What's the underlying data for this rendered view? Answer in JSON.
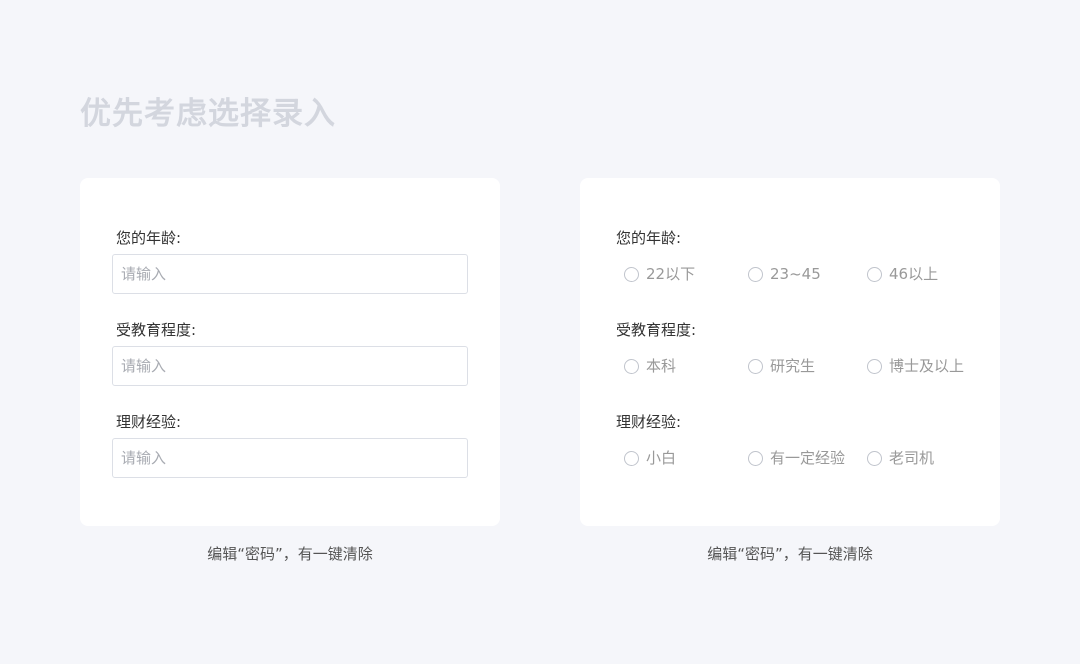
{
  "page_title": "优先考虑选择录入",
  "left_card": {
    "fields": [
      {
        "label": "您的年龄:",
        "placeholder": "请输入"
      },
      {
        "label": "受教育程度:",
        "placeholder": "请输入"
      },
      {
        "label": "理财经验:",
        "placeholder": "请输入"
      }
    ],
    "caption": "编辑“密码”，有一键清除"
  },
  "right_card": {
    "groups": [
      {
        "label": "您的年龄:",
        "options": [
          "22以下",
          "23~45",
          "46以上"
        ]
      },
      {
        "label": "受教育程度:",
        "options": [
          "本科",
          "研究生",
          "博士及以上"
        ]
      },
      {
        "label": "理财经验:",
        "options": [
          "小白",
          "有一定经验",
          "老司机"
        ]
      }
    ],
    "caption": "编辑“密码”，有一键清除"
  },
  "colors": {
    "background": "#f5f6fa",
    "card": "#ffffff",
    "title": "#d3d6de",
    "label": "#333333",
    "placeholder": "#a8abb2",
    "border": "#dcdfe6"
  }
}
